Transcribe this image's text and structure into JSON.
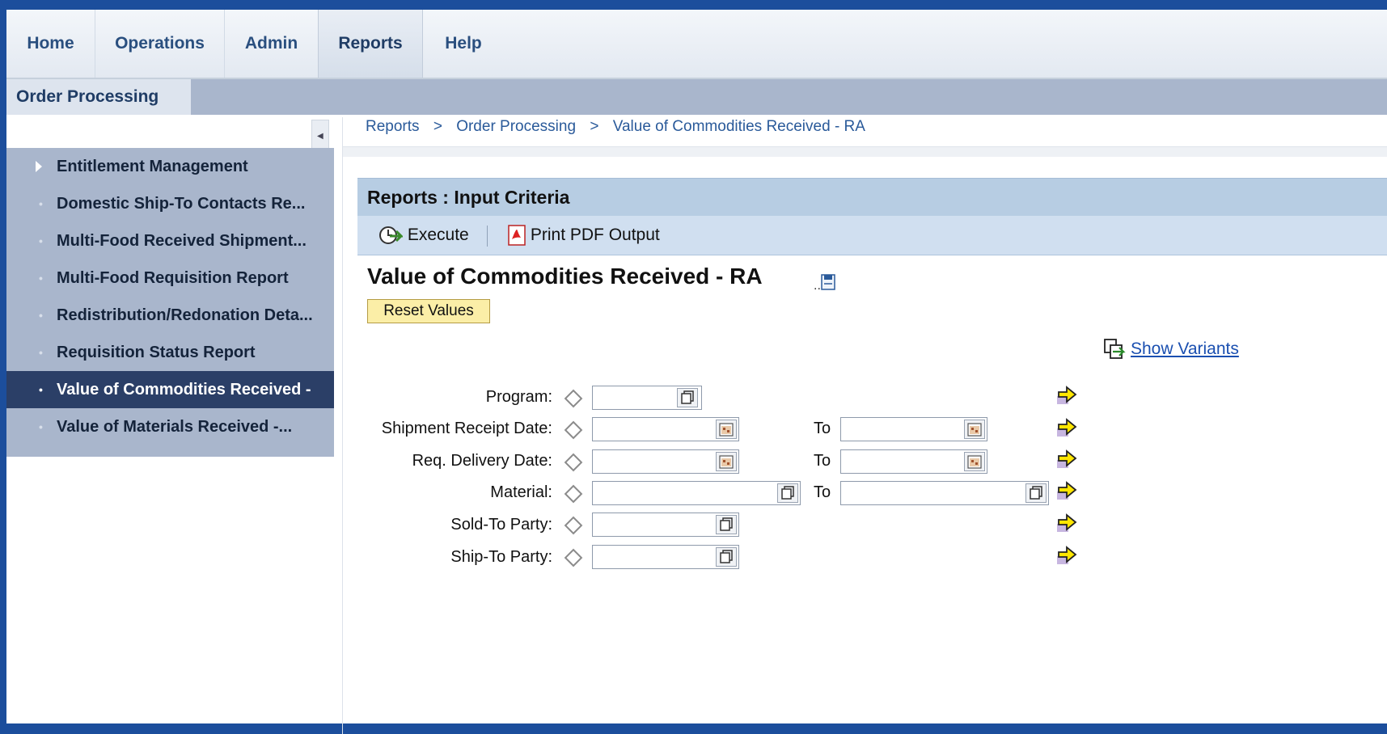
{
  "topnav": {
    "tabs": [
      {
        "label": "Home"
      },
      {
        "label": "Operations"
      },
      {
        "label": "Admin"
      },
      {
        "label": "Reports"
      },
      {
        "label": "Help"
      }
    ]
  },
  "subnav": {
    "label": "Order Processing"
  },
  "leftnav": {
    "items": [
      {
        "label": "Entitlement Management"
      },
      {
        "label": "Domestic Ship-To Contacts Re..."
      },
      {
        "label": "Multi-Food Received Shipment..."
      },
      {
        "label": "Multi-Food Requisition Report"
      },
      {
        "label": "Redistribution/Redonation Deta..."
      },
      {
        "label": "Requisition Status Report"
      },
      {
        "label": "Value of Commodities Received -"
      },
      {
        "label": "Value of Materials Received -..."
      }
    ]
  },
  "breadcrumb": {
    "items": [
      "Reports",
      "Order Processing",
      "Value of Commodities Received - RA"
    ],
    "separator": ">"
  },
  "panel": {
    "header": "Reports : Input Criteria",
    "execute_label": "Execute",
    "print_label": "Print PDF Output",
    "title": "Value of Commodities Received - RA",
    "reset_label": "Reset Values",
    "variants_label": "Show Variants"
  },
  "form": {
    "to_label": "To",
    "fields": [
      {
        "label": "Program:",
        "value": ""
      },
      {
        "label": "Shipment Receipt Date:",
        "value_from": "",
        "value_to": ""
      },
      {
        "label": "Req. Delivery Date:",
        "value_from": "",
        "value_to": ""
      },
      {
        "label": "Material:",
        "value_from": "",
        "value_to": ""
      },
      {
        "label": "Sold-To Party:",
        "value": ""
      },
      {
        "label": "Ship-To Party:",
        "value": ""
      }
    ]
  },
  "colors": {
    "frame_border": "#1c4e9c",
    "nav_text": "#2a4f7f",
    "active_nav_bg": "#2b3f67",
    "panel_header_bg": "#b7cde3",
    "reset_bg": "#fbeea7",
    "link": "#1a4fb0"
  }
}
